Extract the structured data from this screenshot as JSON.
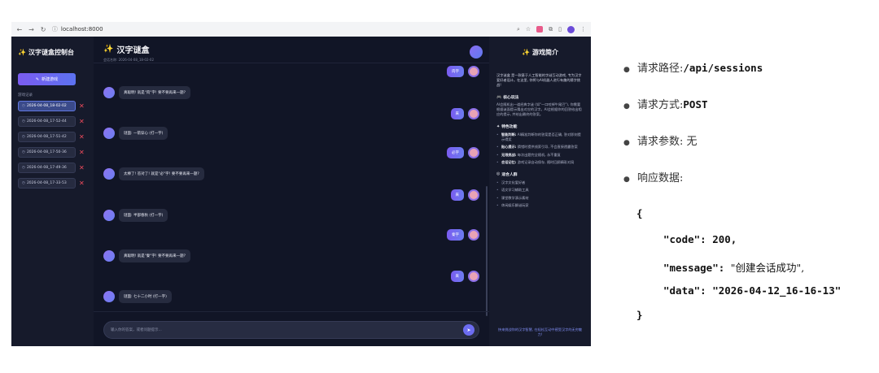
{
  "browser": {
    "url": "localhost:8000"
  },
  "sidebar": {
    "title": "汉字谜盒控制台",
    "new_button": "新建游戏",
    "section_label": "游戏记录",
    "sessions": [
      {
        "label": "2026-04-08_18-02-02",
        "active": true
      },
      {
        "label": "2026-04-08_17-52-44",
        "active": false
      },
      {
        "label": "2026-04-08_17-51-42",
        "active": false
      },
      {
        "label": "2026-04-08_17-50-36",
        "active": false
      },
      {
        "label": "2026-04-08_17-49-36",
        "active": false
      },
      {
        "label": "2026-04-08_17-33-53",
        "active": false
      }
    ]
  },
  "main": {
    "title": "汉字谜盒",
    "subtitle": "会话名称: 2026-04-08_18-02-02",
    "input_placeholder": "输入你的答案，或者问题提示..."
  },
  "chat": [
    {
      "role": "user",
      "text": "肉字"
    },
    {
      "role": "bot",
      "text": "真聪明! 就是\"肉\"字! 要不要再来一题?"
    },
    {
      "role": "user",
      "text": "来"
    },
    {
      "role": "bot",
      "text": "谜面: 一箭穿心 (打一字)"
    },
    {
      "role": "user",
      "text": "必字"
    },
    {
      "role": "bot",
      "text": "太棒了! 答对了! 就是\"必\"字! 要不要再来一题?"
    },
    {
      "role": "user",
      "text": "来"
    },
    {
      "role": "bot",
      "text": "谜面: 半部春秋 (打一字)"
    },
    {
      "role": "user",
      "text": "秦字"
    },
    {
      "role": "bot",
      "text": "真聪明! 就是\"秦\"字! 要不要再来一题?"
    },
    {
      "role": "user",
      "text": "来"
    },
    {
      "role": "bot",
      "text": "谜面: 七十二小时 (打一字)"
    }
  ],
  "rpanel": {
    "title": "游戏简介",
    "intro": "汉字谜盒 是一款基于人工智能的字谜互动游戏, 专为汉字爱好者设计。在这里, 你将与AI机器人进行有趣的猜字挑战!",
    "core_title": "核心玩法",
    "core_text": "AI会随机出一道经典字谜 (如\"一口咬掉牛尾巴\"), 你需要根据谜面提示猜出对应的汉字。AI会根据你的回答给出相应的提示, 并给出最终的答案。",
    "features_title": "特色功能",
    "features": [
      {
        "name": "智能判断:",
        "desc": "AI精准判断你的答案是否正确, 答对即刻提示得奖"
      },
      {
        "name": "贴心提示:",
        "desc": "猜错时提供线索引导, 不会直接透露答案"
      },
      {
        "name": "无限挑战:",
        "desc": "每次出题完全随机, 永不重复"
      },
      {
        "name": "会话记忆:",
        "desc": "游戏记录自动保存, 随时回顾精彩对局"
      }
    ],
    "audience_title": "适合人群",
    "audience": [
      "汉字文化爱好者",
      "语文学习辅助工具",
      "课堂教学演示素材",
      "休闲娱乐解谜玩家"
    ],
    "footer": "快来挑战你的汉字智慧, 在轻松互动中感受汉字的无穷魅力!"
  },
  "notes": {
    "path_label": "请求路径: ",
    "path_value": "/api/sessions",
    "method_label": "请求方式: ",
    "method_value": "POST",
    "params_label": "请求参数: 无",
    "response_label": "响应数据:",
    "json_open": "{",
    "json_code_key": "\"code\": ",
    "json_code_val": "200,",
    "json_msg_key": "\"message\": ",
    "json_msg_val": "\"创建会话成功\",",
    "json_data_key": "\"data\": ",
    "json_data_val": "\"2026-04-12_16-16-13\"",
    "json_close": "}"
  }
}
